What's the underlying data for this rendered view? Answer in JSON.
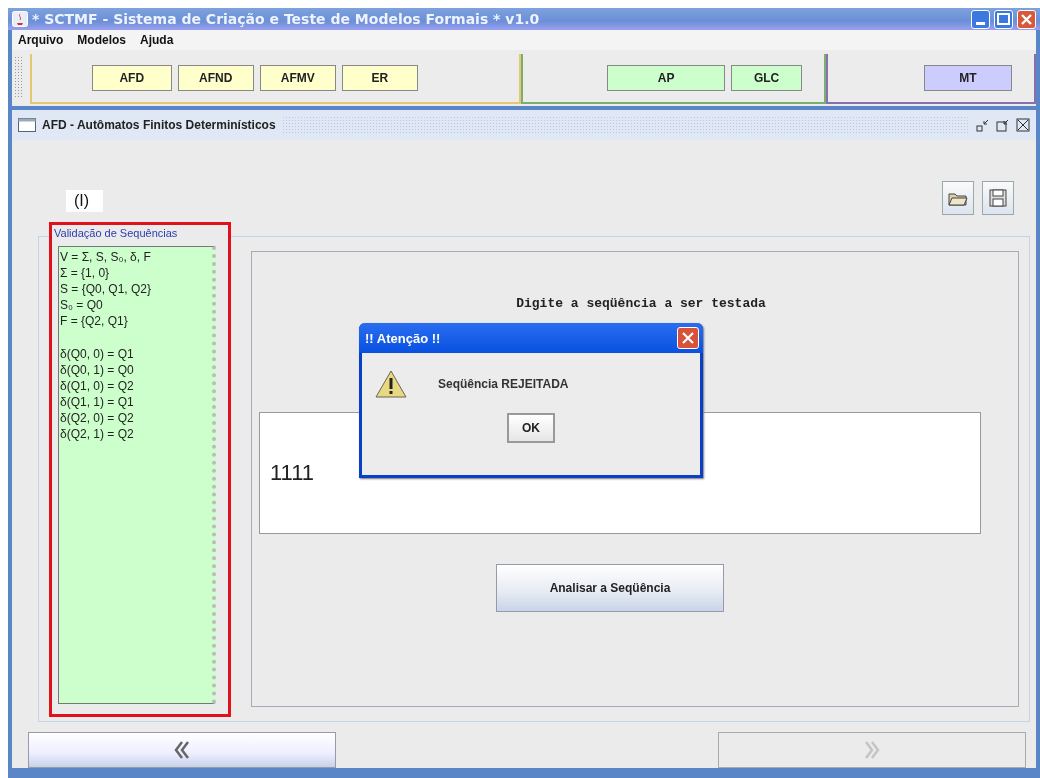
{
  "window": {
    "title": "* SCTMF - Sistema de Criação e Teste de Modelos Formais * v1.0"
  },
  "menu": [
    "Arquivo",
    "Modelos",
    "Ajuda"
  ],
  "toolbar_groups": [
    {
      "color": "#ffffcc",
      "buttons": [
        "AFD",
        "AFND",
        "AFMV",
        "ER"
      ]
    },
    {
      "color": "#ccffcc",
      "buttons": [
        "AP",
        "GLC"
      ]
    },
    {
      "color": "#ccccff",
      "buttons": [
        "MT"
      ]
    }
  ],
  "internal_frame": {
    "title": "AFD - Autômatos Finitos Determinísticos"
  },
  "marker": "(I)",
  "panel": {
    "title": "Validação de Sequências",
    "definitions": [
      "V = Σ, S, S₀, δ, F",
      "Σ = {1, 0}",
      "S = {Q0, Q1, Q2}",
      "S₀ = Q0",
      "F = {Q2, Q1}"
    ],
    "transitions": [
      "δ(Q0, 0) = Q1",
      "δ(Q0, 1) = Q0",
      "δ(Q1, 0) = Q2",
      "δ(Q1, 1) = Q1",
      "δ(Q2, 0) = Q2",
      "δ(Q2, 1) = Q2"
    ]
  },
  "prompt": "Digite a seqüência a ser testada",
  "sequence_input": {
    "value": "1111"
  },
  "analyze_button": "Analisar a Seqüência",
  "nav_buttons": [
    {
      "kind": "back",
      "disabled": false
    },
    {
      "kind": "forward",
      "disabled": true
    }
  ],
  "dialog": {
    "title": "!! Atenção !!",
    "message": "Seqüência REJEITADA",
    "ok": "OK"
  }
}
